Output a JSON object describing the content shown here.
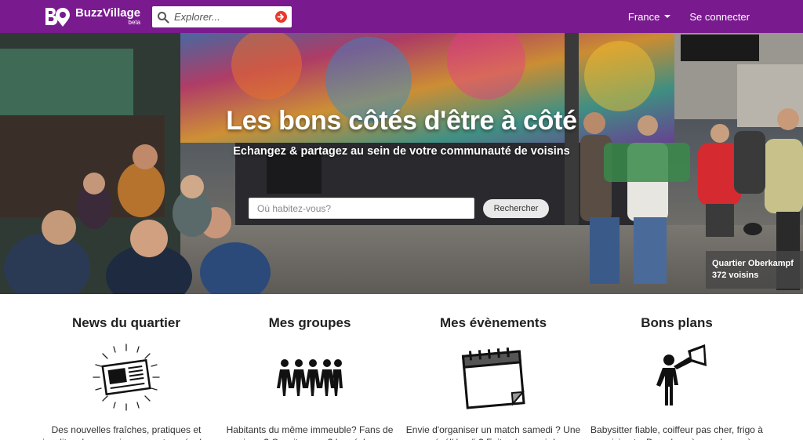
{
  "navbar": {
    "brand": "BuzzVillage",
    "brand_tag": "beta",
    "search_placeholder": "Explorer...",
    "country": "France",
    "login": "Se connecter"
  },
  "hero": {
    "title": "Les bons côtés d'être à côté",
    "subtitle": "Echangez & partagez au sein de votre communauté de voisins",
    "address_placeholder": "Où habitez-vous?",
    "search_button": "Rechercher",
    "neighborhood": "Quartier Oberkampf",
    "neighbors_count": "372 voisins"
  },
  "features": [
    {
      "title": "News du quartier",
      "icon": "newspaper-icon",
      "desc": "Des nouvelles fraîches, pratiques et insolites. Les concierges vont se régaler"
    },
    {
      "title": "Mes groupes",
      "icon": "people-group-icon",
      "desc": "Habitants du même immeuble? Fans de musique ? Covoitureurs ? Les échanges"
    },
    {
      "title": "Mes évènements",
      "icon": "calendar-icon",
      "desc": "Envie d'organiser un match samedi ? Une révél' lundi ? Faites-le savoir !"
    },
    {
      "title": "Bons plans",
      "icon": "megaphone-icon",
      "desc": "Babysitter fiable, coiffeur pas cher, frigo à saisir, etc. Des plans à prendre ou à"
    }
  ],
  "colors": {
    "brand": "#7a1a8f",
    "go_button": "#e8382c"
  }
}
